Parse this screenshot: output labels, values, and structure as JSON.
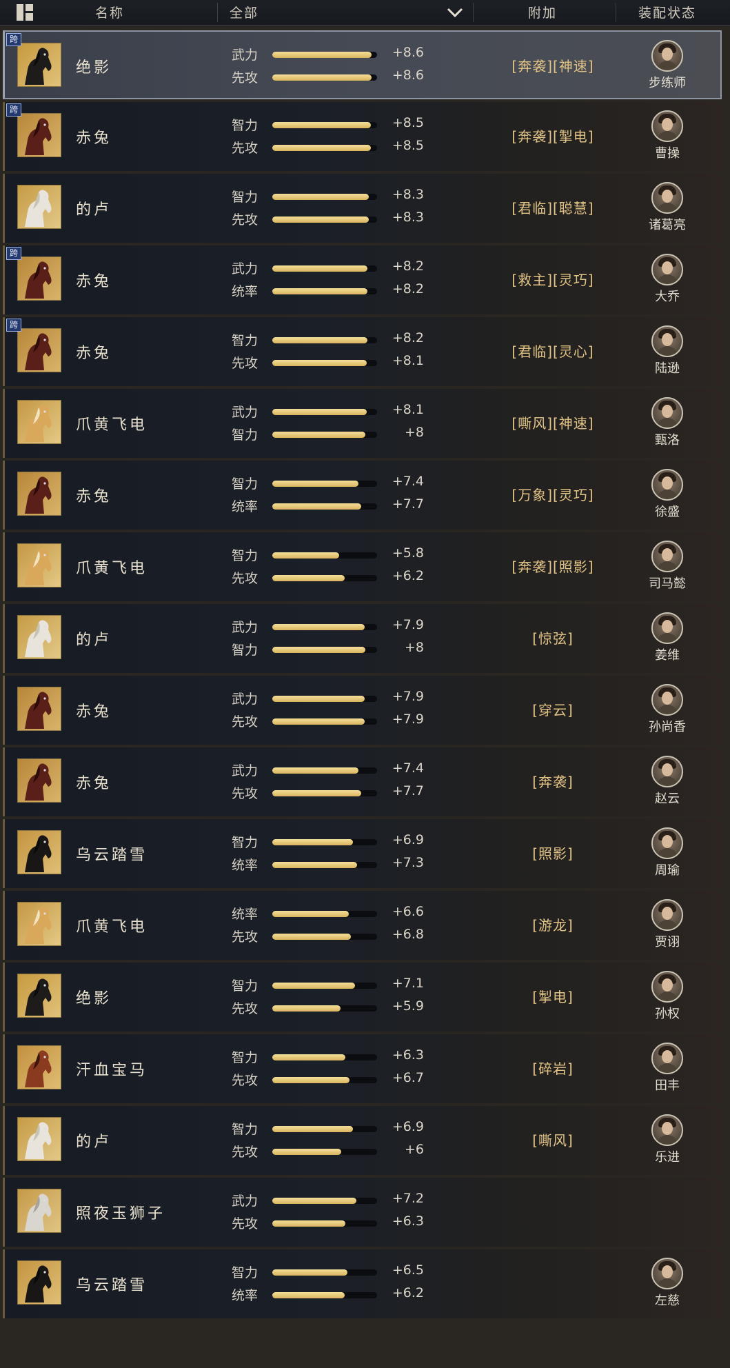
{
  "header": {
    "col_name": "名称",
    "filter_value": "全部",
    "col_bonus": "附加",
    "col_equip": "装配状态"
  },
  "rows": [
    {
      "name": "绝影",
      "horse": "black",
      "cross": true,
      "cross_label": "跨",
      "s1_label": "武力",
      "s1_val": "+8.6",
      "s1_level": 0.95,
      "s2_label": "先攻",
      "s2_val": "+8.6",
      "s2_level": 0.95,
      "skills": "[奔袭][神速]",
      "general": "步练师",
      "selected": true
    },
    {
      "name": "赤兔",
      "horse": "red",
      "cross": true,
      "cross_label": "跨",
      "s1_label": "智力",
      "s1_val": "+8.5",
      "s1_level": 0.94,
      "s2_label": "先攻",
      "s2_val": "+8.5",
      "s2_level": 0.94,
      "skills": "[奔袭][掣电]",
      "general": "曹操"
    },
    {
      "name": "的卢",
      "horse": "white",
      "cross": false,
      "s1_label": "智力",
      "s1_val": "+8.3",
      "s1_level": 0.92,
      "s2_label": "先攻",
      "s2_val": "+8.3",
      "s2_level": 0.92,
      "skills": "[君临][聪慧]",
      "general": "诸葛亮"
    },
    {
      "name": "赤兔",
      "horse": "red",
      "cross": true,
      "cross_label": "跨",
      "s1_label": "武力",
      "s1_val": "+8.2",
      "s1_level": 0.91,
      "s2_label": "统率",
      "s2_val": "+8.2",
      "s2_level": 0.91,
      "skills": "[救主][灵巧]",
      "general": "大乔"
    },
    {
      "name": "赤兔",
      "horse": "red",
      "cross": true,
      "cross_label": "跨",
      "s1_label": "智力",
      "s1_val": "+8.2",
      "s1_level": 0.91,
      "s2_label": "先攻",
      "s2_val": "+8.1",
      "s2_level": 0.9,
      "skills": "[君临][灵心]",
      "general": "陆逊"
    },
    {
      "name": "爪黄飞电",
      "horse": "gold",
      "cross": false,
      "s1_label": "武力",
      "s1_val": "+8.1",
      "s1_level": 0.9,
      "s2_label": "智力",
      "s2_val": "+8",
      "s2_level": 0.89,
      "skills": "[嘶风][神速]",
      "general": "甄洛"
    },
    {
      "name": "赤兔",
      "horse": "red",
      "cross": false,
      "s1_label": "智力",
      "s1_val": "+7.4",
      "s1_level": 0.82,
      "s2_label": "统率",
      "s2_val": "+7.7",
      "s2_level": 0.85,
      "skills": "[万象][灵巧]",
      "general": "徐盛"
    },
    {
      "name": "爪黄飞电",
      "horse": "gold",
      "cross": false,
      "s1_label": "智力",
      "s1_val": "+5.8",
      "s1_level": 0.64,
      "s2_label": "先攻",
      "s2_val": "+6.2",
      "s2_level": 0.69,
      "skills": "[奔袭][照影]",
      "general": "司马懿"
    },
    {
      "name": "的卢",
      "horse": "white",
      "cross": false,
      "s1_label": "武力",
      "s1_val": "+7.9",
      "s1_level": 0.88,
      "s2_label": "智力",
      "s2_val": "+8",
      "s2_level": 0.89,
      "skills": "[惊弦]",
      "general": "姜维"
    },
    {
      "name": "赤兔",
      "horse": "red",
      "cross": false,
      "s1_label": "武力",
      "s1_val": "+7.9",
      "s1_level": 0.88,
      "s2_label": "先攻",
      "s2_val": "+7.9",
      "s2_level": 0.88,
      "skills": "[穿云]",
      "general": "孙尚香"
    },
    {
      "name": "赤兔",
      "horse": "red",
      "cross": false,
      "s1_label": "武力",
      "s1_val": "+7.4",
      "s1_level": 0.82,
      "s2_label": "先攻",
      "s2_val": "+7.7",
      "s2_level": 0.85,
      "skills": "[奔袭]",
      "general": "赵云"
    },
    {
      "name": "乌云踏雪",
      "horse": "dark",
      "cross": false,
      "s1_label": "智力",
      "s1_val": "+6.9",
      "s1_level": 0.77,
      "s2_label": "统率",
      "s2_val": "+7.3",
      "s2_level": 0.81,
      "skills": "[照影]",
      "general": "周瑜"
    },
    {
      "name": "爪黄飞电",
      "horse": "gold",
      "cross": false,
      "s1_label": "统率",
      "s1_val": "+6.6",
      "s1_level": 0.73,
      "s2_label": "先攻",
      "s2_val": "+6.8",
      "s2_level": 0.75,
      "skills": "[游龙]",
      "general": "贾诩"
    },
    {
      "name": "绝影",
      "horse": "black",
      "cross": false,
      "s1_label": "智力",
      "s1_val": "+7.1",
      "s1_level": 0.79,
      "s2_label": "先攻",
      "s2_val": "+5.9",
      "s2_level": 0.65,
      "skills": "[掣电]",
      "general": "孙权"
    },
    {
      "name": "汗血宝马",
      "horse": "chestnut",
      "cross": false,
      "s1_label": "智力",
      "s1_val": "+6.3",
      "s1_level": 0.7,
      "s2_label": "先攻",
      "s2_val": "+6.7",
      "s2_level": 0.74,
      "skills": "[碎岩]",
      "general": "田丰"
    },
    {
      "name": "的卢",
      "horse": "white",
      "cross": false,
      "s1_label": "智力",
      "s1_val": "+6.9",
      "s1_level": 0.77,
      "s2_label": "先攻",
      "s2_val": "+6",
      "s2_level": 0.66,
      "skills": "[嘶风]",
      "general": "乐进"
    },
    {
      "name": "照夜玉狮子",
      "horse": "silver",
      "cross": false,
      "s1_label": "武力",
      "s1_val": "+7.2",
      "s1_level": 0.8,
      "s2_label": "先攻",
      "s2_val": "+6.3",
      "s2_level": 0.7,
      "skills": "",
      "general": ""
    },
    {
      "name": "乌云踏雪",
      "horse": "dark",
      "cross": false,
      "s1_label": "智力",
      "s1_val": "+6.5",
      "s1_level": 0.72,
      "s2_label": "统率",
      "s2_val": "+6.2",
      "s2_level": 0.69,
      "skills": "",
      "general": "左慈"
    }
  ],
  "horse_colors": {
    "black": {
      "bg1": "#c79a3f",
      "bg2": "#e0c27a",
      "body": "#1e1c1b",
      "mane": "#0d0c0c"
    },
    "red": {
      "bg1": "#b8873a",
      "bg2": "#d8b46a",
      "body": "#5b1f1a",
      "mane": "#2a0d0b"
    },
    "white": {
      "bg1": "#c69b45",
      "bg2": "#e2c987",
      "body": "#e8e4dc",
      "mane": "#c9c3b6"
    },
    "gold": {
      "bg1": "#c59845",
      "bg2": "#e4c985",
      "body": "#d9a85a",
      "mane": "#f2e4c0"
    },
    "dark": {
      "bg1": "#c49440",
      "bg2": "#dfbf77",
      "body": "#191716",
      "mane": "#0a0909"
    },
    "chestnut": {
      "bg1": "#c3913f",
      "bg2": "#dfbd74",
      "body": "#8a3a1f",
      "mane": "#3b160c"
    },
    "silver": {
      "bg1": "#c59a48",
      "bg2": "#e0c584",
      "body": "#d9d6d0",
      "mane": "#a8a39a"
    }
  }
}
